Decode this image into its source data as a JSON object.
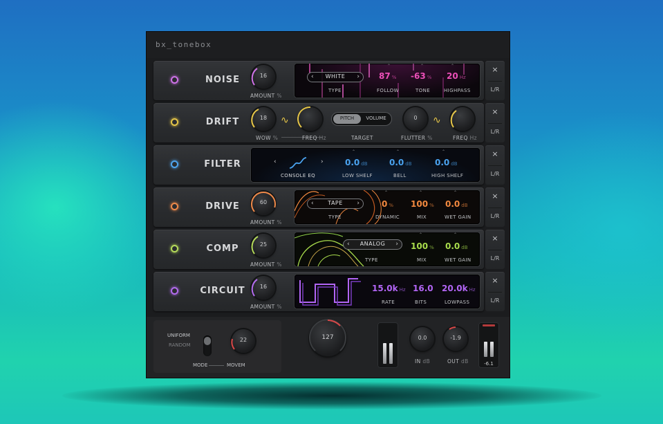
{
  "title": "bx_tonebox",
  "modules": [
    {
      "name": "NOISE",
      "led": "#cf72e8",
      "amount_value": "16",
      "amount_label": "AMOUNT",
      "amount_unit": "%",
      "type_value": "WHITE",
      "type_label": "TYPE",
      "params": [
        {
          "value": "87",
          "unit": "%",
          "label": "FOLLOW"
        },
        {
          "value": "-63",
          "unit": "%",
          "label": "TONE"
        },
        {
          "value": "20",
          "unit": "Hz",
          "label": "HIGHPASS"
        }
      ],
      "color": "#ec4fb8",
      "side_x": "×",
      "side_lr": "L/R"
    },
    {
      "name": "DRIFT",
      "led": "#e6c648",
      "wow_value": "18",
      "wow_label": "WOW",
      "wow_unit": "%",
      "freq_label": "FREQ",
      "freq_unit": "Hz",
      "target_options": [
        "PITCH",
        "VOLUME"
      ],
      "target_label": "TARGET",
      "flutter_value": "0",
      "flutter_label": "FLUTTER",
      "flutter_unit": "%",
      "freq2_label": "FREQ",
      "freq2_unit": "Hz",
      "side_x": "×",
      "side_lr": "L/R"
    },
    {
      "name": "FILTER",
      "led": "#4fa6ef",
      "type_value": "CONSOLE EQ",
      "params": [
        {
          "value": "0.0",
          "unit": "dB",
          "label": "LOW SHELF"
        },
        {
          "value": "0.0",
          "unit": "dB",
          "label": "BELL"
        },
        {
          "value": "0.0",
          "unit": "dB",
          "label": "HIGH SHELF"
        }
      ],
      "color": "#4aa3f0",
      "side_x": "×",
      "side_lr": "L/R"
    },
    {
      "name": "DRIVE",
      "led": "#f08a4a",
      "amount_value": "60",
      "amount_label": "AMOUNT",
      "amount_unit": "%",
      "type_value": "TAPE",
      "type_label": "TYPE",
      "params": [
        {
          "value": "0",
          "unit": "%",
          "label": "DYNAMIC"
        },
        {
          "value": "100",
          "unit": "%",
          "label": "MIX"
        },
        {
          "value": "0.0",
          "unit": "dB",
          "label": "WET GAIN"
        }
      ],
      "color": "#f2893f",
      "side_x": "×",
      "side_lr": "L/R"
    },
    {
      "name": "COMP",
      "led": "#b6dc5a",
      "amount_value": "25",
      "amount_label": "AMOUNT",
      "amount_unit": "%",
      "type_value": "ANALOG",
      "type_label": "TYPE",
      "params": [
        {
          "value": "100",
          "unit": "%",
          "label": "MIX"
        },
        {
          "value": "0.0",
          "unit": "dB",
          "label": "WET GAIN"
        }
      ],
      "color": "#a8dc4c",
      "side_x": "×",
      "side_lr": "L/R"
    },
    {
      "name": "CIRCUIT",
      "led": "#b46cf0",
      "amount_value": "16",
      "amount_label": "AMOUNT",
      "amount_unit": "%",
      "params": [
        {
          "value": "15.0k",
          "unit": "Hz",
          "label": "RATE"
        },
        {
          "value": "16.0",
          "unit": "",
          "label": "BITS"
        },
        {
          "value": "20.0k",
          "unit": "Hz",
          "label": "LOWPASS"
        }
      ],
      "color": "#b265f5",
      "side_x": "×",
      "side_lr": "L/R"
    }
  ],
  "bottom": {
    "mode_options": [
      "UNIFORM",
      "RANDOM"
    ],
    "mode_label": "MODE",
    "movement_value": "22",
    "movement_label": "MOVEM",
    "main_value": "127",
    "in_value": "0.0",
    "in_label": "IN",
    "in_unit": "dB",
    "out_value": "-1.9",
    "out_label": "OUT",
    "out_unit": "dB",
    "meter_readout": "-6.1"
  }
}
